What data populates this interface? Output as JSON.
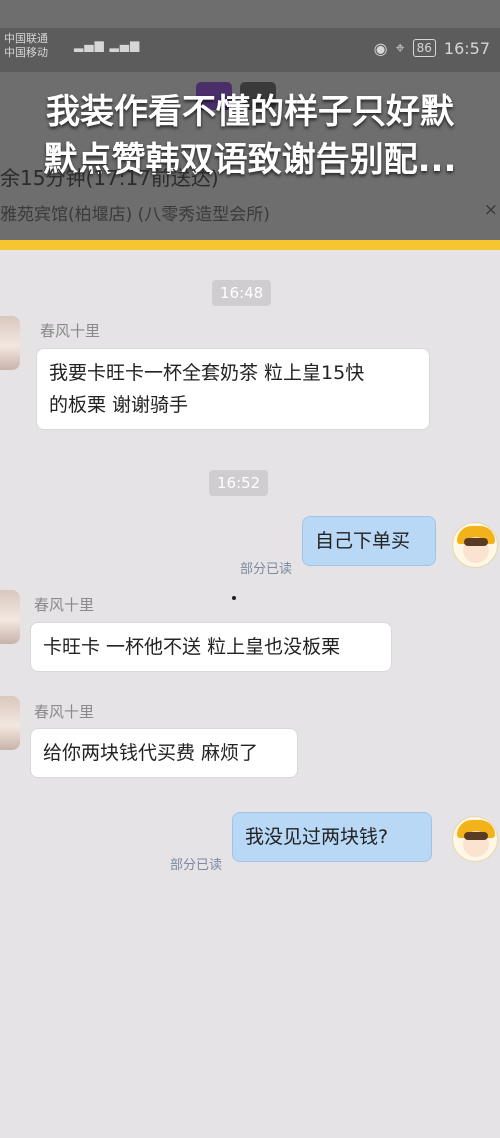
{
  "status_bar": {
    "carrier1": "中国联通",
    "carrier2": "中国移动",
    "network1": "4G",
    "battery": "86",
    "time": "16:57"
  },
  "caption": {
    "line1": "我装作看不懂的样子只好默",
    "line2": "默点赞韩双语致谢告别配..."
  },
  "order": {
    "partial_line": "余15分钟(17:17前送达)",
    "shop": "雅苑宾馆(柏堰店) (八零秀造型会所)",
    "close": "×"
  },
  "colors": {
    "accent_yellow": "#f5c532",
    "out_bubble": "#b8d8f6",
    "in_bubble": "#ffffff"
  },
  "messages": [
    {
      "time": "16:48"
    },
    {
      "sender": "春风十里",
      "text_line1": "我要卡旺卡一杯全套奶茶 粒上皇15快",
      "text_line2": "的板栗 谢谢骑手"
    },
    {
      "time": "16:52"
    },
    {
      "text": "自己下单买",
      "read": "部分已读"
    },
    {
      "sender": "春风十里",
      "text": "卡旺卡 一杯他不送 粒上皇也没板栗"
    },
    {
      "sender": "春风十里",
      "text": "给你两块钱代买费 麻烦了"
    },
    {
      "text": "我没见过两块钱?",
      "read": "部分已读"
    }
  ]
}
